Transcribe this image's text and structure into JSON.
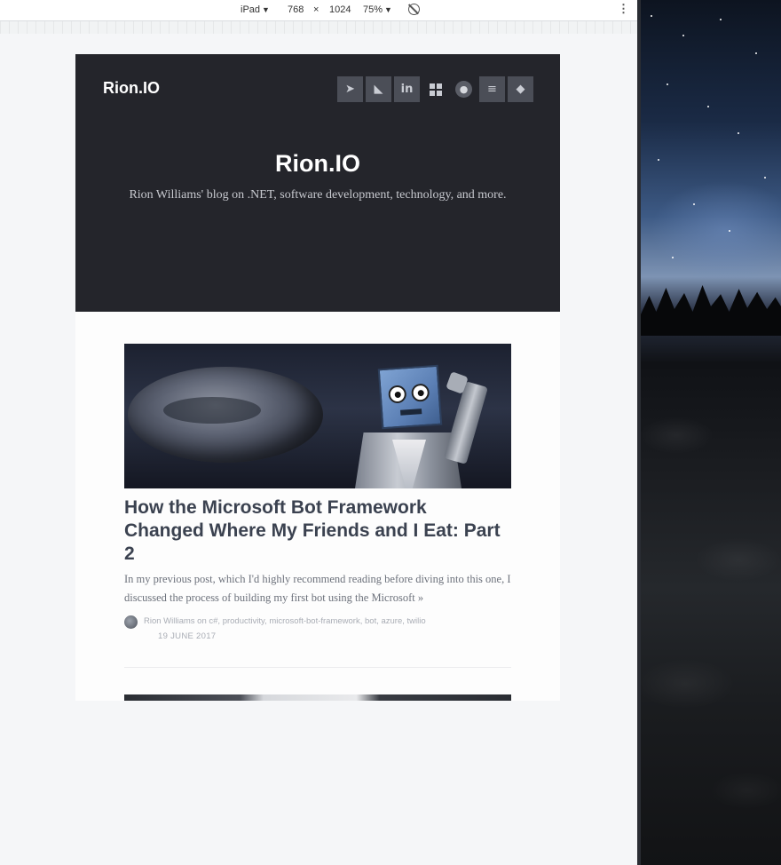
{
  "devtools": {
    "device": "iPad",
    "width": "768",
    "times": "×",
    "height": "1024",
    "zoom": "75%",
    "caret": "▼",
    "menu_glyph": "⋮"
  },
  "site": {
    "brand": "Rion.IO",
    "title": "Rion.IO",
    "tagline": "Rion Williams' blog on .NET, software development, technology, and more.",
    "social_icons": [
      "twitter-icon",
      "rss-icon",
      "linkedin-icon",
      "windows-icon",
      "github-icon",
      "stackoverflow-icon",
      "git-icon"
    ],
    "social_glyphs": {
      "twitter": "➤",
      "rss": "◣",
      "linkedin": "in",
      "github": "●",
      "stackoverflow": "≡",
      "git": "◆"
    }
  },
  "post": {
    "title": "How the Microsoft Bot Framework Changed Where My Friends and I Eat: Part 2",
    "excerpt": "In my previous post, which I'd highly recommend reading before diving into this one, I discussed the process of building my first bot using the Microsoft »",
    "byline": "Rion Williams on c#, productivity, microsoft-bot-framework, bot, azure, twilio",
    "date": "19 JUNE 2017"
  },
  "colors": {
    "header_bg": "#24252b",
    "social_button_bg": "#4b4e57",
    "post_title": "#3b4250",
    "page_bg": "#fdfdfd"
  }
}
